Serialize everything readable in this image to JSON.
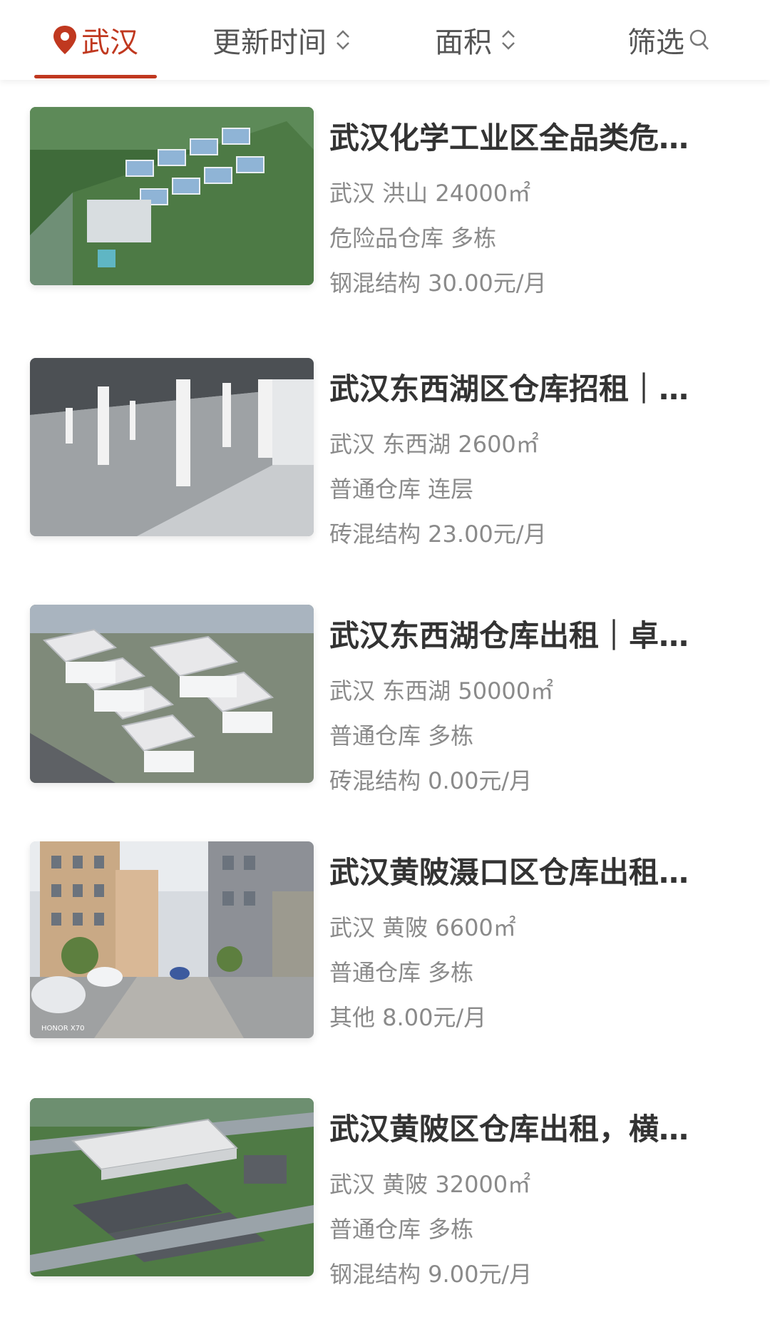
{
  "header": {
    "city_label": "武汉",
    "update_time_label": "更新时间",
    "area_label": "面积",
    "filter_label": "筛选",
    "accent_color": "#c0381f"
  },
  "listings": [
    {
      "title": "武汉化学工业区全品类危化品仓库出租",
      "location_area": "武汉 洪山 24000㎡",
      "type_floors": "危险品仓库 多栋",
      "structure_price": "钢混结构 30.00元/月"
    },
    {
      "title": "武汉东西湖区仓库招租｜高标仓库出租",
      "location_area": "武汉 东西湖 2600㎡",
      "type_floors": "普通仓库 连层",
      "structure_price": "砖混结构 23.00元/月"
    },
    {
      "title": "武汉东西湖仓库出租｜卓尔物流园仓库",
      "location_area": "武汉 东西湖 50000㎡",
      "type_floors": "普通仓库 多栋",
      "structure_price": "砖混结构 0.00元/月"
    },
    {
      "title": "武汉黄陂滠口区仓库出租厂房出租",
      "location_area": "武汉 黄陂 6600㎡",
      "type_floors": "普通仓库 多栋",
      "structure_price": "其他 8.00元/月",
      "photo_watermark": "HONOR X70"
    },
    {
      "title": "武汉黄陂区仓库出租，横店物流园仓库",
      "location_area": "武汉 黄陂 32000㎡",
      "type_floors": "普通仓库 多栋",
      "structure_price": "钢混结构 9.00元/月"
    }
  ]
}
